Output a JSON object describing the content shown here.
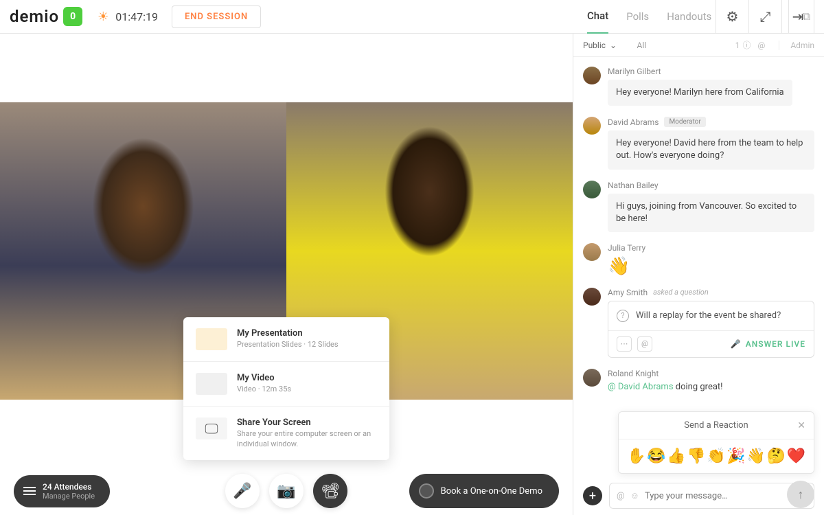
{
  "header": {
    "logo_text": "demio",
    "logo_badge": "0",
    "timer": "01:47:19",
    "end_session": "END SESSION"
  },
  "tabs": {
    "chat": "Chat",
    "polls": "Polls",
    "handouts": "Handouts"
  },
  "filter": {
    "public": "Public",
    "all": "All",
    "count": "1",
    "admin": "Admin"
  },
  "share": {
    "item1": {
      "title": "My Presentation",
      "sub": "Presentation Slides · 12 Slides"
    },
    "item2": {
      "title": "My Video",
      "sub": "Video · 12m 35s"
    },
    "item3": {
      "title": "Share Your Screen",
      "sub": "Share your entire computer screen or an individual window."
    }
  },
  "attendees": {
    "count": "24 Attendees",
    "sub": "Manage People"
  },
  "demo_btn": "Book a One-on-One Demo",
  "messages": {
    "m1": {
      "name": "Marilyn Gilbert",
      "text": "Hey everyone! Marilyn here from California"
    },
    "m2": {
      "name": "David Abrams",
      "badge": "Moderator",
      "text": "Hey everyone! David here from the team to help out. How's everyone doing?"
    },
    "m3": {
      "name": "Nathan Bailey",
      "text": "Hi guys, joining from Vancouver. So excited to be here!"
    },
    "m4": {
      "name": "Julia Terry",
      "text": "👋"
    },
    "m5": {
      "name": "Amy Smith",
      "asked": "asked a question",
      "text": "Will a replay for the event be shared?",
      "answer": "ANSWER LIVE"
    },
    "m6": {
      "name": "Roland Knight",
      "mention": "@ David Abrams",
      "text": " doing great!"
    }
  },
  "reaction": {
    "title": "Send a Reaction",
    "emojis": [
      "✋",
      "😂",
      "👍",
      "👎",
      "👏",
      "🎉",
      "👋",
      "🤔",
      "❤️"
    ]
  },
  "input": {
    "placeholder": "Type your message…"
  }
}
